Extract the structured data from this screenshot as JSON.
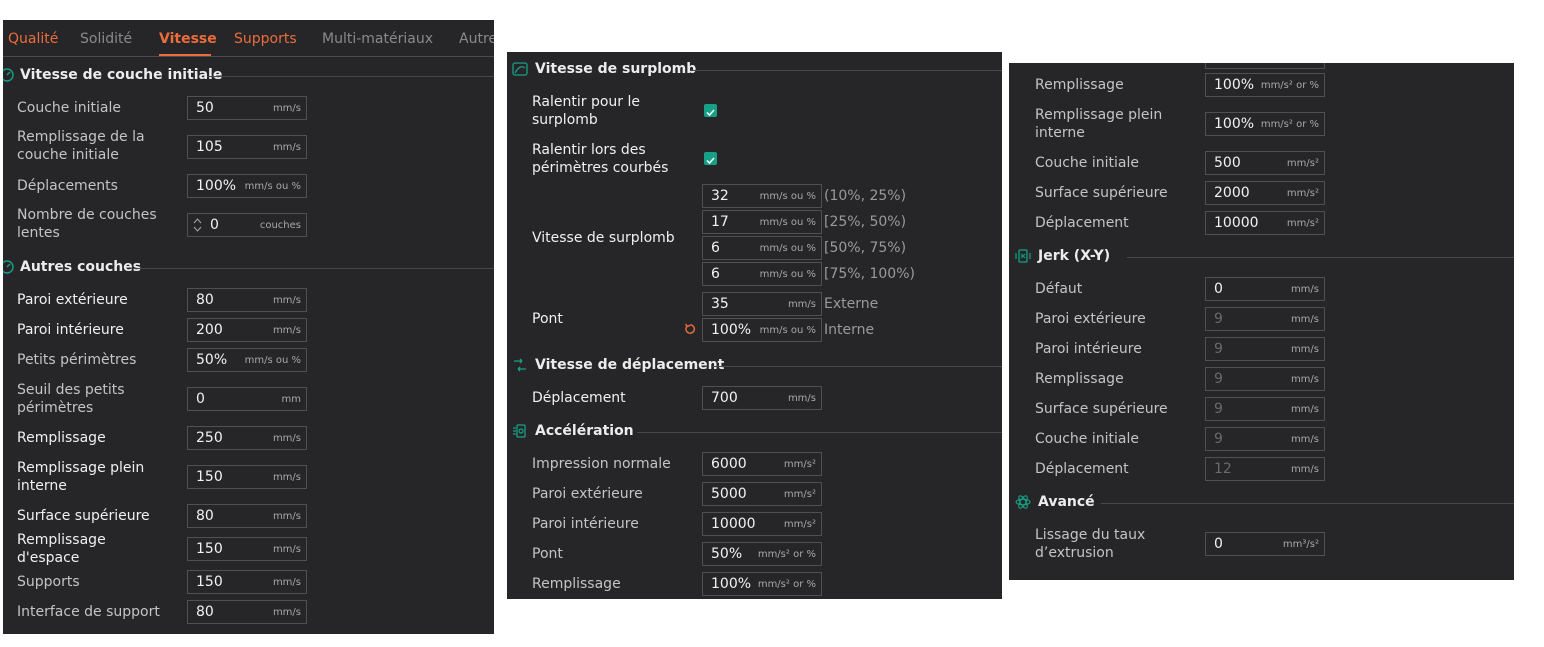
{
  "tabs": [
    "Qualité",
    "Solidité",
    "Vitesse",
    "Supports",
    "Multi-matériaux",
    "Autres"
  ],
  "panel1": {
    "initial_title": "Vitesse de couche initiale",
    "initial_rows": [
      {
        "label": "Couche initiale",
        "value": "50",
        "unit": "mm/s"
      },
      {
        "label": "Remplissage de la couche initiale",
        "value": "105",
        "unit": "mm/s"
      },
      {
        "label": "Déplacements",
        "value": "100%",
        "unit": "mm/s ou %"
      },
      {
        "label": "Nombre de couches lentes",
        "value": "0",
        "unit": "couches"
      }
    ],
    "other_title": "Autres couches",
    "other_rows": [
      {
        "label": "Paroi extérieure",
        "value": "80",
        "unit": "mm/s"
      },
      {
        "label": "Paroi intérieure",
        "value": "200",
        "unit": "mm/s"
      },
      {
        "label": "Petits périmètres",
        "value": "50%",
        "unit": "mm/s ou %"
      },
      {
        "label": "Seuil des petits périmètres",
        "value": "0",
        "unit": "mm"
      },
      {
        "label": "Remplissage",
        "value": "250",
        "unit": "mm/s"
      },
      {
        "label": "Remplissage plein interne",
        "value": "150",
        "unit": "mm/s"
      },
      {
        "label": "Surface supérieure",
        "value": "80",
        "unit": "mm/s"
      },
      {
        "label": "Remplissage d'espace",
        "value": "150",
        "unit": "mm/s"
      },
      {
        "label": "Supports",
        "value": "150",
        "unit": "mm/s"
      },
      {
        "label": "Interface de support",
        "value": "80",
        "unit": "mm/s"
      }
    ]
  },
  "panel2": {
    "overhang_title": "Vitesse de surplomb",
    "slow_overhang_label": "Ralentir pour le surplomb",
    "slow_curled_label": "Ralentir lors des périmètres courbés",
    "overhang_speed_label": "Vitesse de surplomb",
    "overhang_rows": [
      {
        "value": "32",
        "unit": "mm/s ou %",
        "range": "(10%, 25%)"
      },
      {
        "value": "17",
        "unit": "mm/s ou %",
        "range": "[25%, 50%)"
      },
      {
        "value": "6",
        "unit": "mm/s ou %",
        "range": "[50%, 75%)"
      },
      {
        "value": "6",
        "unit": "mm/s ou %",
        "range": "[75%, 100%)"
      }
    ],
    "bridge_label": "Pont",
    "bridge_rows": [
      {
        "value": "35",
        "unit": "mm/s",
        "note": "Externe"
      },
      {
        "value": "100%",
        "unit": "mm/s ou %",
        "note": "Interne"
      }
    ],
    "travel_title": "Vitesse de déplacement",
    "travel_rows": [
      {
        "label": "Déplacement",
        "value": "700",
        "unit": "mm/s"
      }
    ],
    "accel_title": "Accélération",
    "accel_rows": [
      {
        "label": "Impression normale",
        "value": "6000",
        "unit": "mm/s²"
      },
      {
        "label": "Paroi extérieure",
        "value": "5000",
        "unit": "mm/s²"
      },
      {
        "label": "Paroi intérieure",
        "value": "10000",
        "unit": "mm/s²"
      },
      {
        "label": "Pont",
        "value": "50%",
        "unit": "mm/s² or %"
      },
      {
        "label": "Remplissage",
        "value": "100%",
        "unit": "mm/s² or %"
      }
    ]
  },
  "panel3": {
    "accel_rows": [
      {
        "label": "Remplissage",
        "value": "100%",
        "unit": "mm/s² or %"
      },
      {
        "label": "Remplissage plein interne",
        "value": "100%",
        "unit": "mm/s² or %"
      },
      {
        "label": "Couche initiale",
        "value": "500",
        "unit": "mm/s²"
      },
      {
        "label": "Surface supérieure",
        "value": "2000",
        "unit": "mm/s²"
      },
      {
        "label": "Déplacement",
        "value": "10000",
        "unit": "mm/s²"
      }
    ],
    "jerk_title": "Jerk (X-Y)",
    "jerk_rows": [
      {
        "label": "Défaut",
        "value": "0",
        "unit": "mm/s"
      },
      {
        "label": "Paroi extérieure",
        "value": "9",
        "unit": "mm/s"
      },
      {
        "label": "Paroi intérieure",
        "value": "9",
        "unit": "mm/s"
      },
      {
        "label": "Remplissage",
        "value": "9",
        "unit": "mm/s"
      },
      {
        "label": "Surface supérieure",
        "value": "9",
        "unit": "mm/s"
      },
      {
        "label": "Couche initiale",
        "value": "9",
        "unit": "mm/s"
      },
      {
        "label": "Déplacement",
        "value": "12",
        "unit": "mm/s"
      }
    ],
    "advanced_title": "Avancé",
    "advanced_rows": [
      {
        "label": "Lissage du taux d’extrusion",
        "value": "0",
        "unit": "mm³/s²"
      }
    ]
  },
  "colors": {
    "panel_bg": "#262629",
    "accent_orange": "#ec6c3c",
    "checkbox_teal": "#16a086",
    "field_border": "#4f4f54"
  }
}
